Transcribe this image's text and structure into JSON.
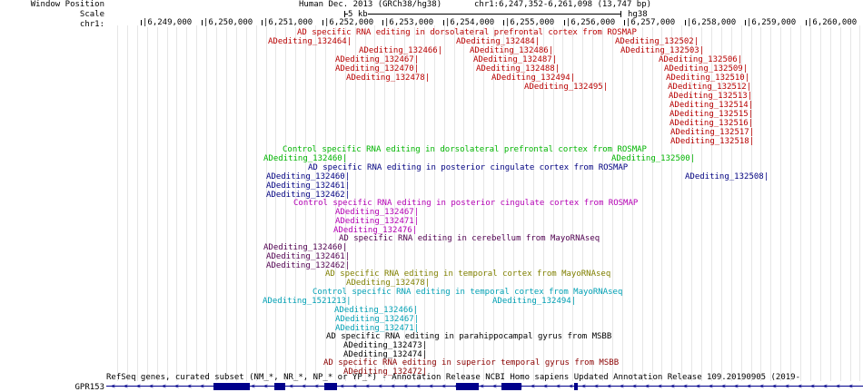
{
  "side_labels": {
    "window_position": "Window Position",
    "scale": "Scale",
    "chrom": "chr1:",
    "gene_track": "GPR153"
  },
  "header": {
    "assembly": "Human Dec. 2013 (GRCh38/hg38)",
    "position": "chr1:6,247,352-6,261,098 (13,747 bp)",
    "scale_text": "5 kb",
    "scale_assembly": "hg38"
  },
  "ruler_ticks": [
    "6,249,000",
    "6,250,000",
    "6,251,000",
    "6,252,000",
    "6,253,000",
    "6,254,000",
    "6,255,000",
    "6,256,000",
    "6,257,000",
    "6,258,000",
    "6,259,000",
    "6,260,000",
    "6,261,000"
  ],
  "colors": {
    "ad_dlpfc": "#b80000",
    "ctrl_dlpfc": "#00b400",
    "ad_pcc": "#000080",
    "ctrl_pcc": "#b400b4",
    "ad_cereb": "#500050",
    "ad_tcx": "#808000",
    "ctrl_tcx": "#00a0b4",
    "ad_phg": "#000000",
    "ad_stg": "#8b0000",
    "gene": "#00008b"
  },
  "tracks": [
    {
      "key": "ad_dlpfc",
      "title": "AD specific RNA editing in dorsolateral prefrontal cortex from ROSMAP",
      "items": [
        "ADediting_132464",
        "ADediting_132484",
        "ADediting_132502",
        "ADediting_132466",
        "ADediting_132486",
        "ADediting_132503",
        "ADediting_132467",
        "ADediting_132487",
        "ADediting_132506",
        "ADediting_132470",
        "ADediting_132488",
        "ADediting_132509",
        "ADediting_132478",
        "ADediting_132494",
        "ADediting_132510",
        "ADediting_132495",
        "ADediting_132512",
        "ADediting_132513",
        "ADediting_132514",
        "ADediting_132515",
        "ADediting_132516",
        "ADediting_132517",
        "ADediting_132518"
      ]
    },
    {
      "key": "ctrl_dlpfc",
      "title": "Control specific RNA editing in dorsolateral prefrontal cortex from ROSMAP",
      "items": [
        "ADediting_132460",
        "ADediting_132500"
      ]
    },
    {
      "key": "ad_pcc",
      "title": "AD specific RNA editing in posterior cingulate cortex from ROSMAP",
      "items": [
        "ADediting_132460",
        "ADediting_132508",
        "ADediting_132461",
        "ADediting_132462"
      ]
    },
    {
      "key": "ctrl_pcc",
      "title": "Control specific RNA editing in posterior cingulate cortex from ROSMAP",
      "items": [
        "ADediting_132467",
        "ADediting_132471",
        "ADediting_132476"
      ]
    },
    {
      "key": "ad_cereb",
      "title": "AD specific RNA editing in cerebellum from MayoRNAseq",
      "items": [
        "ADediting_132460",
        "ADediting_132461",
        "ADediting_132462"
      ]
    },
    {
      "key": "ad_tcx",
      "title": "AD specific RNA editing in temporal cortex from MayoRNAseq",
      "items": [
        "ADediting_132478"
      ]
    },
    {
      "key": "ctrl_tcx",
      "title": "Control specific RNA editing in temporal cortex from MayoRNAseq",
      "items": [
        "ADediting_1521213",
        "ADediting_132494",
        "ADediting_132466",
        "ADediting_132467",
        "ADediting_132471"
      ]
    },
    {
      "key": "ad_phg",
      "title": "AD specific RNA editing in parahippocampal gyrus from MSBB",
      "items": [
        "ADediting_132473",
        "ADediting_132474"
      ]
    },
    {
      "key": "ad_stg",
      "title": "AD specific RNA editing in superior temporal gyrus from MSBB",
      "items": [
        "ADediting_132472"
      ]
    }
  ],
  "gene_track_title": "RefSeq genes, curated subset (NM_*, NR_*, NP_* or YP_*) - Annotation Release NCBI Homo sapiens Updated Annotation Release 109.20190905 (2019-"
}
